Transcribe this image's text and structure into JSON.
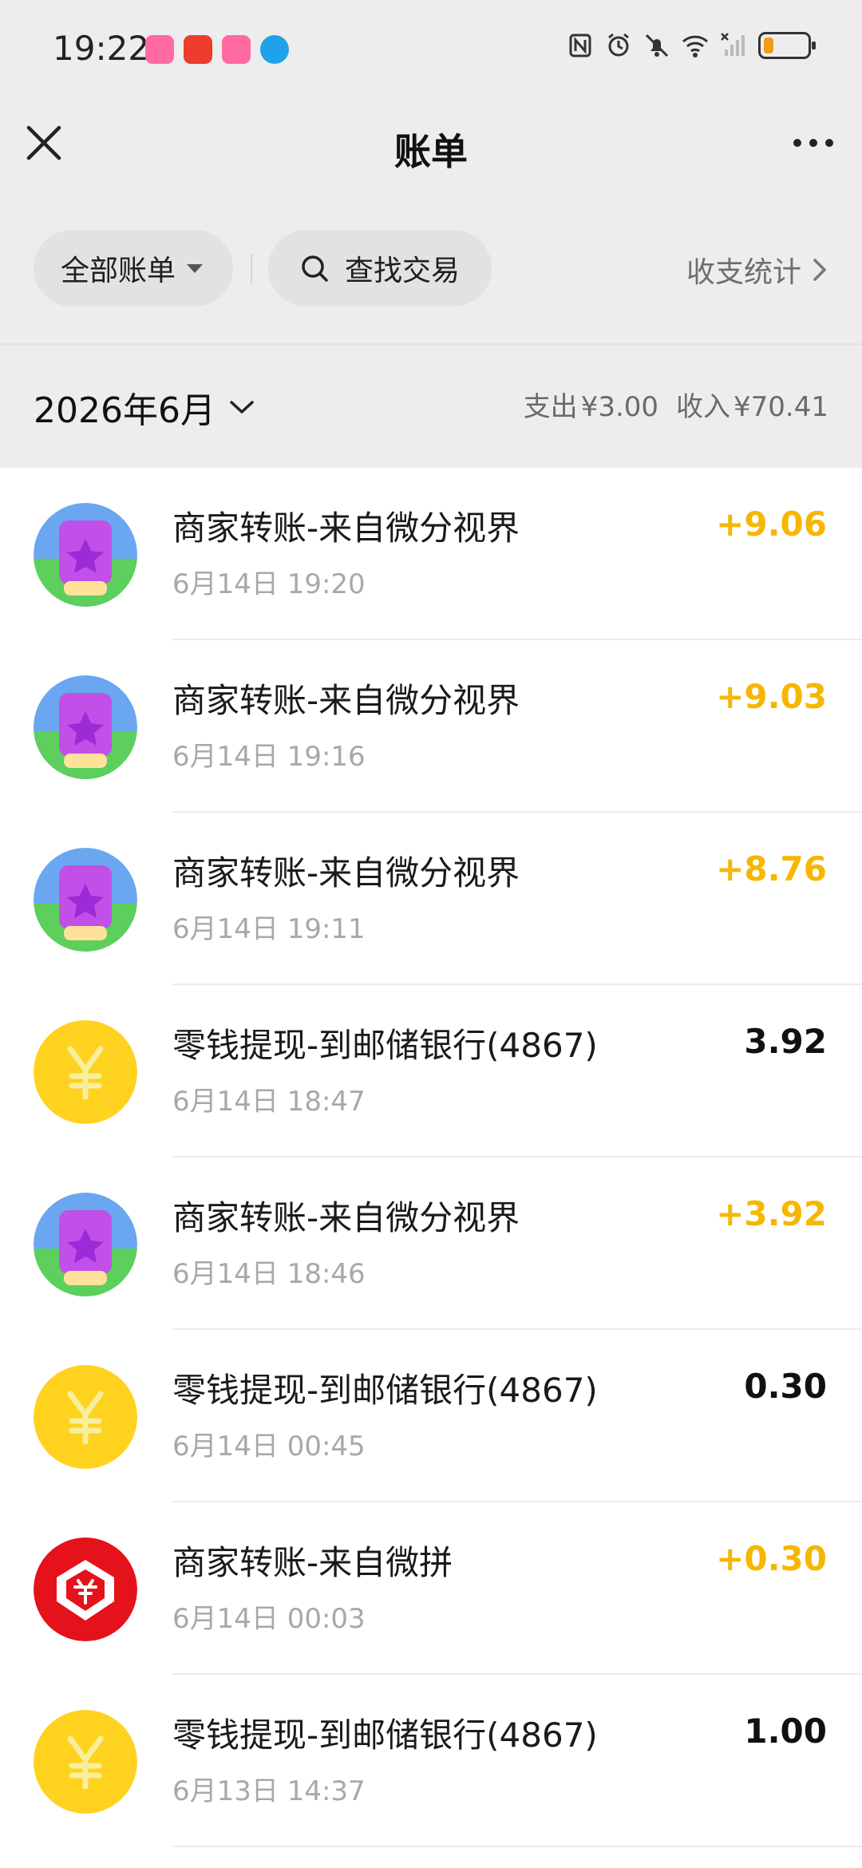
{
  "status_bar": {
    "time": "19:22",
    "app_icons": [
      "618-app-icon",
      "badge-app-icon",
      "618-app-icon",
      "map-app-icon"
    ],
    "icons": [
      "nfc-icon",
      "alarm-icon",
      "mute-icon",
      "wifi-icon",
      "no-signal-icon",
      "battery-icon"
    ]
  },
  "nav": {
    "title": "账单"
  },
  "filters": {
    "all_bills": "全部账单",
    "search": "查找交易",
    "stats": "收支统计"
  },
  "month": {
    "label": "2026年6月",
    "expense_label": "支出",
    "expense_amount": "¥3.00",
    "income_label": "收入",
    "income_amount": "¥70.41"
  },
  "transactions": [
    {
      "title": "商家转账-来自微分视界",
      "time": "6月14日 19:20",
      "amount": "+9.06",
      "type": "income",
      "icon": "game-star-icon"
    },
    {
      "title": "商家转账-来自微分视界",
      "time": "6月14日 19:16",
      "amount": "+9.03",
      "type": "income",
      "icon": "game-star-icon"
    },
    {
      "title": "商家转账-来自微分视界",
      "time": "6月14日 19:11",
      "amount": "+8.76",
      "type": "income",
      "icon": "game-star-icon"
    },
    {
      "title": "零钱提现-到邮储银行(4867)",
      "time": "6月14日 18:47",
      "amount": "3.92",
      "type": "expense",
      "icon": "yuan-coin-icon"
    },
    {
      "title": "商家转账-来自微分视界",
      "time": "6月14日 18:46",
      "amount": "+3.92",
      "type": "income",
      "icon": "game-star-icon"
    },
    {
      "title": "零钱提现-到邮储银行(4867)",
      "time": "6月14日 00:45",
      "amount": "0.30",
      "type": "expense",
      "icon": "yuan-coin-icon"
    },
    {
      "title": "商家转账-来自微拼",
      "time": "6月14日 00:03",
      "amount": "+0.30",
      "type": "income",
      "icon": "pinduoduo-logo-icon"
    },
    {
      "title": "零钱提现-到邮储银行(4867)",
      "time": "6月13日 14:37",
      "amount": "1.00",
      "type": "expense",
      "icon": "yuan-coin-icon"
    }
  ],
  "colors": {
    "income": "#f5b700",
    "expense": "#111111",
    "coin": "#ffd21f",
    "pdd_red": "#e5121c"
  }
}
